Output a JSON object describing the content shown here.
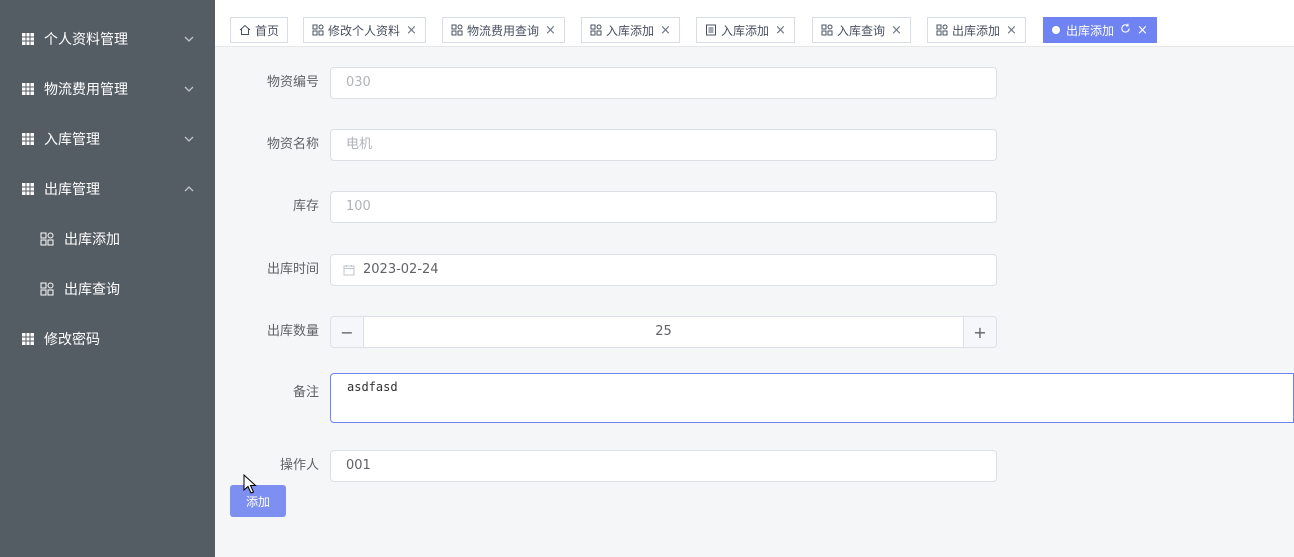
{
  "sidebar": {
    "items": [
      {
        "label": "个人资料管理",
        "expanded": false
      },
      {
        "label": "物流费用管理",
        "expanded": false
      },
      {
        "label": "入库管理",
        "expanded": false
      },
      {
        "label": "出库管理",
        "expanded": true
      },
      {
        "label": "修改密码"
      }
    ],
    "sub_items": [
      {
        "label": "出库添加"
      },
      {
        "label": "出库查询"
      }
    ]
  },
  "tabs": [
    {
      "label": "首页",
      "icon": "home-icon"
    },
    {
      "label": "修改个人资料",
      "icon": "apps-icon"
    },
    {
      "label": "物流费用查询",
      "icon": "apps-icon"
    },
    {
      "label": "入库添加",
      "icon": "apps-icon"
    },
    {
      "label": "入库添加",
      "icon": "receipt-icon"
    },
    {
      "label": "入库查询",
      "icon": "apps-icon"
    },
    {
      "label": "出库添加",
      "icon": "apps-icon"
    },
    {
      "label": "出库添加",
      "icon": "dot",
      "active": true
    }
  ],
  "form": {
    "code_label": "物资编号",
    "code_value": "030",
    "name_label": "物资名称",
    "name_value": "电机",
    "stock_label": "库存",
    "stock_value": "100",
    "time_label": "出库时间",
    "time_value": "2023-02-24",
    "qty_label": "出库数量",
    "qty_value": "25",
    "qty_minus": "−",
    "qty_plus": "+",
    "note_label": "备注",
    "note_value": "asdfasd",
    "operator_label": "操作人",
    "operator_value": "001",
    "submit_label": "添加"
  },
  "colors": {
    "sidebar_bg": "#545c64",
    "accent": "#6f84f2",
    "submit_bg": "#7e8ff2"
  }
}
